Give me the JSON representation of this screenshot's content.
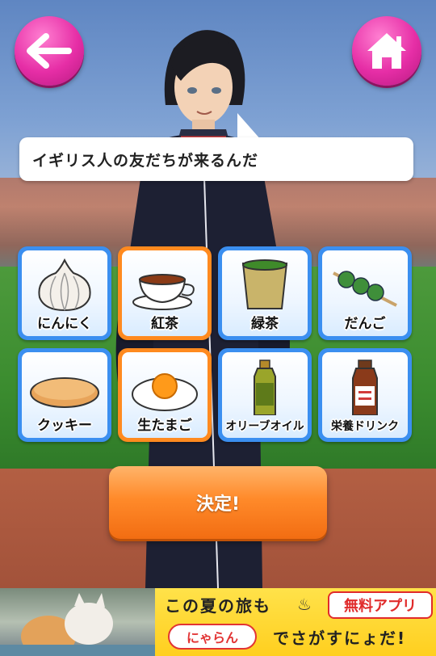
{
  "bubble": {
    "text": "イギリス人の友だちが来るんだ"
  },
  "nav": {
    "back_icon": "arrow-left-icon",
    "home_icon": "home-icon"
  },
  "items": [
    {
      "label": "にんにく",
      "icon": "garlic-icon",
      "selected": false
    },
    {
      "label": "紅茶",
      "icon": "tea-cup-icon",
      "selected": true
    },
    {
      "label": "緑茶",
      "icon": "green-tea-icon",
      "selected": false
    },
    {
      "label": "だんご",
      "icon": "dango-icon",
      "selected": false
    },
    {
      "label": "クッキー",
      "icon": "cookie-icon",
      "selected": false
    },
    {
      "label": "生たまご",
      "icon": "raw-egg-icon",
      "selected": true
    },
    {
      "label": "オリーブオイル",
      "icon": "olive-oil-icon",
      "selected": false
    },
    {
      "label": "栄養ドリンク",
      "icon": "energy-drink-icon",
      "selected": false
    }
  ],
  "decide": {
    "label": "決定!"
  },
  "ad": {
    "line1": "この夏の旅も",
    "badge": "無料アプリ",
    "logo": "にゃらん",
    "line2": "でさがすにょだ!"
  },
  "colors": {
    "accent_pink": "#e62ea6",
    "selected_orange": "#ff8a1f",
    "item_blue": "#3b8ff0",
    "decide_orange": "#ff8a2a"
  }
}
